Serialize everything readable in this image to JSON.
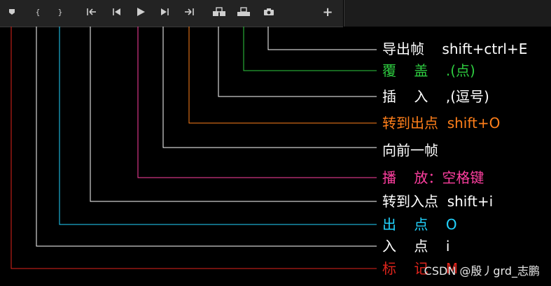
{
  "toolbar": {
    "buttons": [
      {
        "name": "marker-button",
        "icon": "marker-icon"
      },
      {
        "name": "mark-in-button",
        "icon": "mark-in-icon",
        "glyph": "{"
      },
      {
        "name": "mark-out-button",
        "icon": "mark-out-icon",
        "glyph": "}"
      },
      {
        "name": "go-to-in-button",
        "icon": "go-to-in-icon"
      },
      {
        "name": "step-back-button",
        "icon": "step-back-icon"
      },
      {
        "name": "play-button",
        "icon": "play-icon"
      },
      {
        "name": "step-forward-button",
        "icon": "step-forward-icon"
      },
      {
        "name": "go-to-out-button",
        "icon": "go-to-out-icon"
      },
      {
        "name": "insert-button",
        "icon": "insert-icon"
      },
      {
        "name": "overwrite-button",
        "icon": "overwrite-icon"
      },
      {
        "name": "export-frame-button",
        "icon": "camera-icon"
      },
      {
        "name": "add-button",
        "icon": "plus-icon",
        "glyph": "+"
      }
    ]
  },
  "annotations": [
    {
      "text": "导出帧    shift+ctrl+E",
      "color": "#ffffff"
    },
    {
      "text": "覆    盖    .(点)",
      "color": "#2ecc40"
    },
    {
      "text": "插    入    ,(逗号)",
      "color": "#ffffff"
    },
    {
      "text": "转到出点  shift+O",
      "color": "#ff7f1a"
    },
    {
      "text": "向前一帧",
      "color": "#ffffff"
    },
    {
      "text": "播    放：空格键",
      "color": "#ff3fa0"
    },
    {
      "text": "转到入点  shift+i",
      "color": "#ffffff"
    },
    {
      "text": "出    点    O",
      "color": "#22d3ff"
    },
    {
      "text": "入    点    i",
      "color": "#ffffff"
    },
    {
      "text": "标    记    M",
      "color": "#e0241c"
    }
  ],
  "watermark": "CSDN @殷丿grd_志鹏"
}
